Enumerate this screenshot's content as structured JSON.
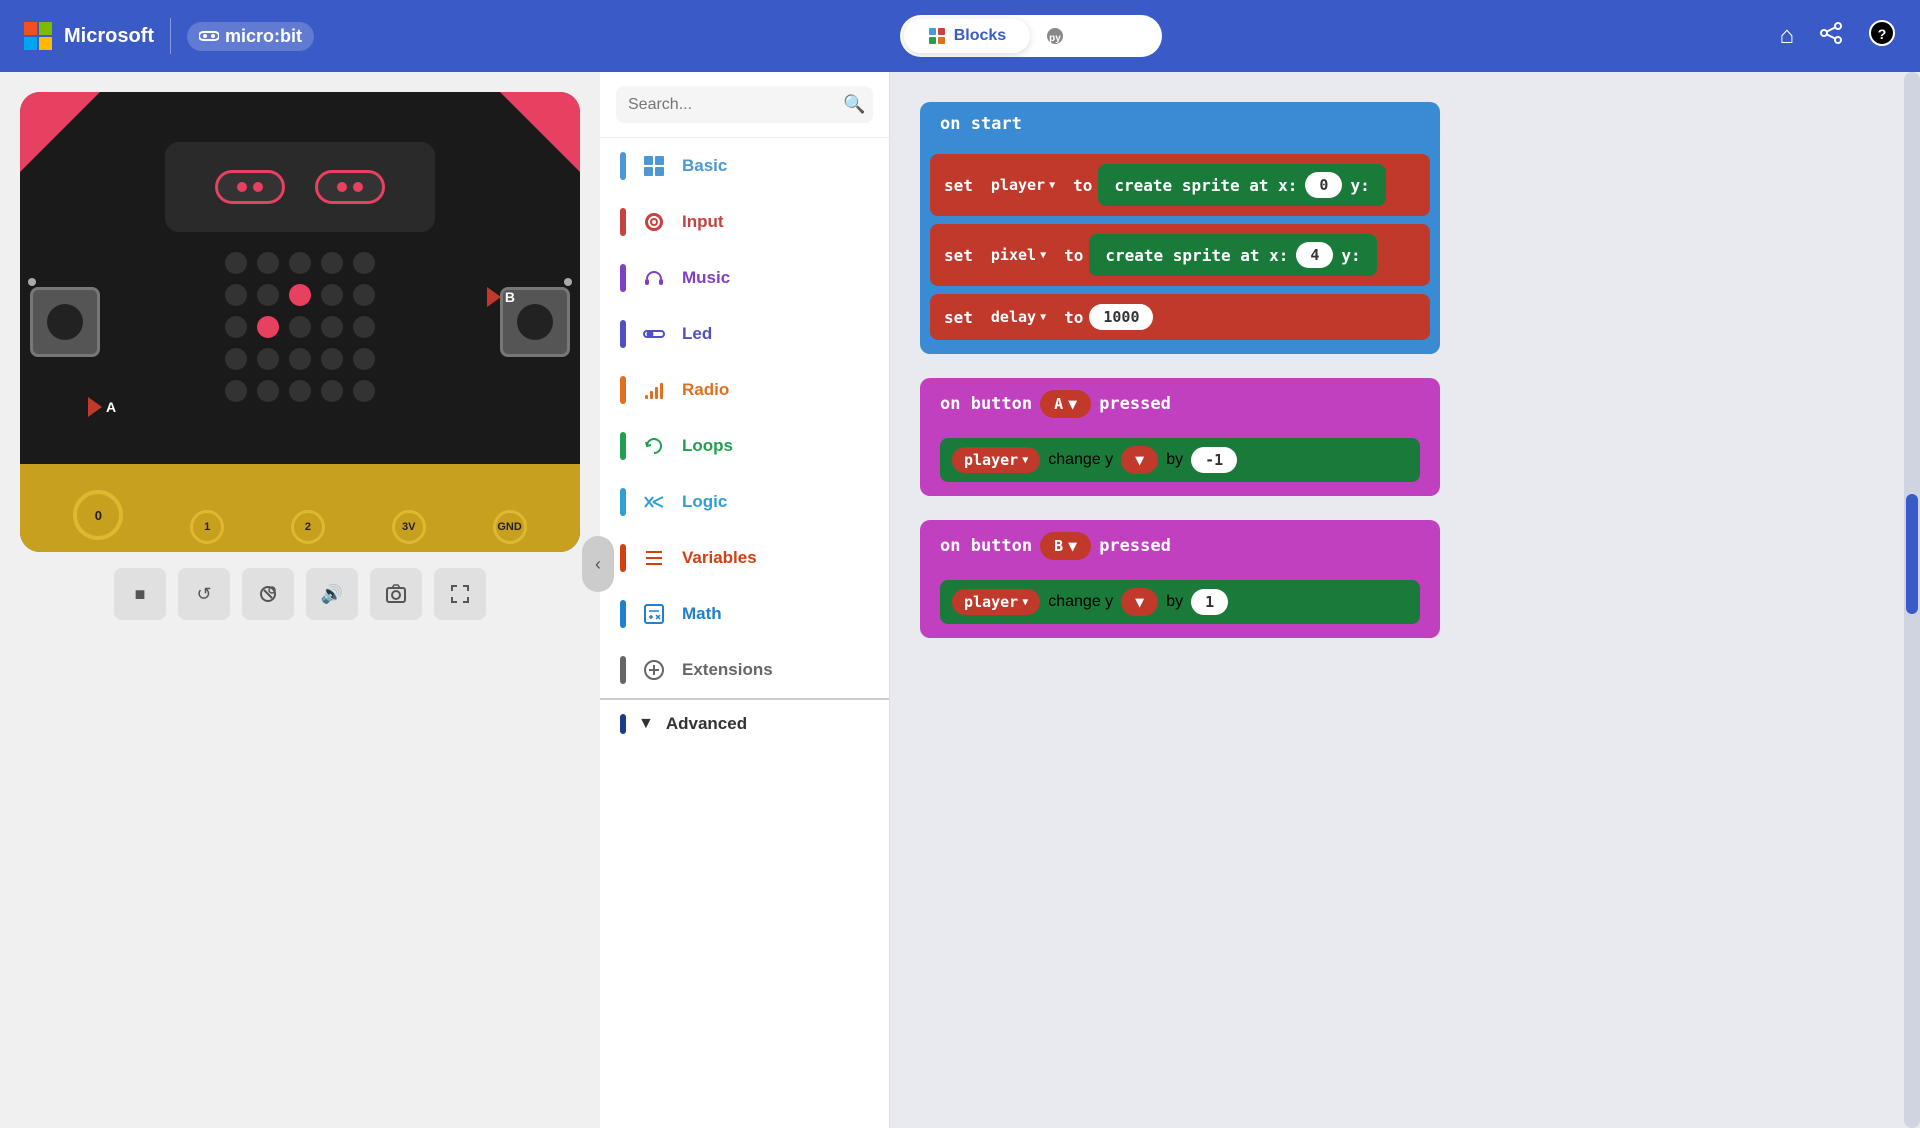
{
  "topnav": {
    "brand": "Microsoft",
    "product": "micro:bit",
    "blocks_label": "Blocks",
    "python_label": "Python",
    "home_icon": "⌂",
    "share_icon": "⊲",
    "help_icon": "?"
  },
  "simulator": {
    "pin_labels": [
      "0",
      "1",
      "2",
      "3V",
      "GND"
    ],
    "controls": {
      "stop": "■",
      "restart": "↺",
      "debug": "🐛",
      "sound": "🔊",
      "screenshot": "📷",
      "fullscreen": "⛶"
    }
  },
  "sidebar": {
    "search_placeholder": "Search...",
    "items": [
      {
        "id": "basic",
        "label": "Basic",
        "color": "#4c97d4"
      },
      {
        "id": "input",
        "label": "Input",
        "color": "#c94040"
      },
      {
        "id": "music",
        "label": "Music",
        "color": "#8040c0"
      },
      {
        "id": "led",
        "label": "Led",
        "color": "#5050c0"
      },
      {
        "id": "radio",
        "label": "Radio",
        "color": "#e07020"
      },
      {
        "id": "loops",
        "label": "Loops",
        "color": "#20a050"
      },
      {
        "id": "logic",
        "label": "Logic",
        "color": "#30a0d0"
      },
      {
        "id": "variables",
        "label": "Variables",
        "color": "#d04010"
      },
      {
        "id": "math",
        "label": "Math",
        "color": "#2080d0"
      },
      {
        "id": "extensions",
        "label": "Extensions",
        "color": "#666"
      },
      {
        "id": "advanced",
        "label": "Advanced",
        "color": "#333"
      }
    ]
  },
  "blocks": {
    "on_start": {
      "header": "on start",
      "rows": [
        {
          "kw": "set",
          "var": "player",
          "to": "to",
          "fn": "create sprite at x:",
          "val1": "0"
        },
        {
          "kw": "set",
          "var": "pixel",
          "to": "to",
          "fn": "create sprite at x:",
          "val1": "4"
        },
        {
          "kw": "set",
          "var": "delay",
          "to": "to",
          "val1": "1000"
        }
      ]
    },
    "on_button_a": {
      "header": "on button",
      "btn": "A",
      "rest": "pressed",
      "inner_var": "player",
      "inner_fn": "change y",
      "inner_kw": "by",
      "inner_val": "-1"
    },
    "on_button_b": {
      "header": "on button",
      "btn": "B",
      "rest": "pressed",
      "inner_var": "player",
      "inner_fn": "change y",
      "inner_kw": "by",
      "inner_val": "1"
    }
  }
}
